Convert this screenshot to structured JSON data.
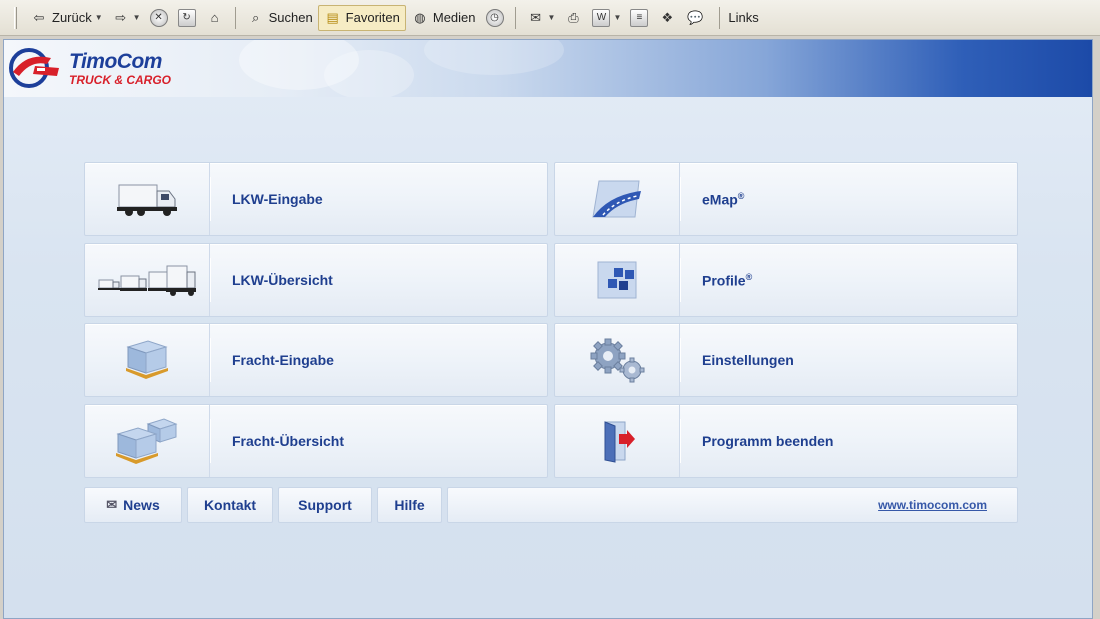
{
  "toolbar": {
    "back": "Zurück",
    "search": "Suchen",
    "favorites": "Favoriten",
    "media": "Medien",
    "links": "Links"
  },
  "brand": {
    "name": "TimoCom",
    "tagline": "TRUCK & CARGO"
  },
  "menu": {
    "left": [
      {
        "label": "LKW-Eingabe",
        "icon": "truck-icon"
      },
      {
        "label": "LKW-Übersicht",
        "icon": "truck-convoy-icon"
      },
      {
        "label": "Fracht-Eingabe",
        "icon": "pallet-box-icon"
      },
      {
        "label": "Fracht-Übersicht",
        "icon": "pallet-boxes-icon"
      }
    ],
    "right": [
      {
        "label": "eMap",
        "reg": "®",
        "icon": "road-map-icon"
      },
      {
        "label": "Profile",
        "reg": "®",
        "icon": "profile-blocks-icon"
      },
      {
        "label": "Einstellungen",
        "icon": "gears-icon"
      },
      {
        "label": "Programm beenden",
        "icon": "exit-door-icon"
      }
    ]
  },
  "footer": {
    "news": "News",
    "contact": "Kontakt",
    "support": "Support",
    "help": "Hilfe",
    "website": "www.timocom.com"
  },
  "colors": {
    "brand_blue": "#1d3f9a",
    "brand_red": "#d8202a",
    "label_blue": "#1f3f8f"
  }
}
